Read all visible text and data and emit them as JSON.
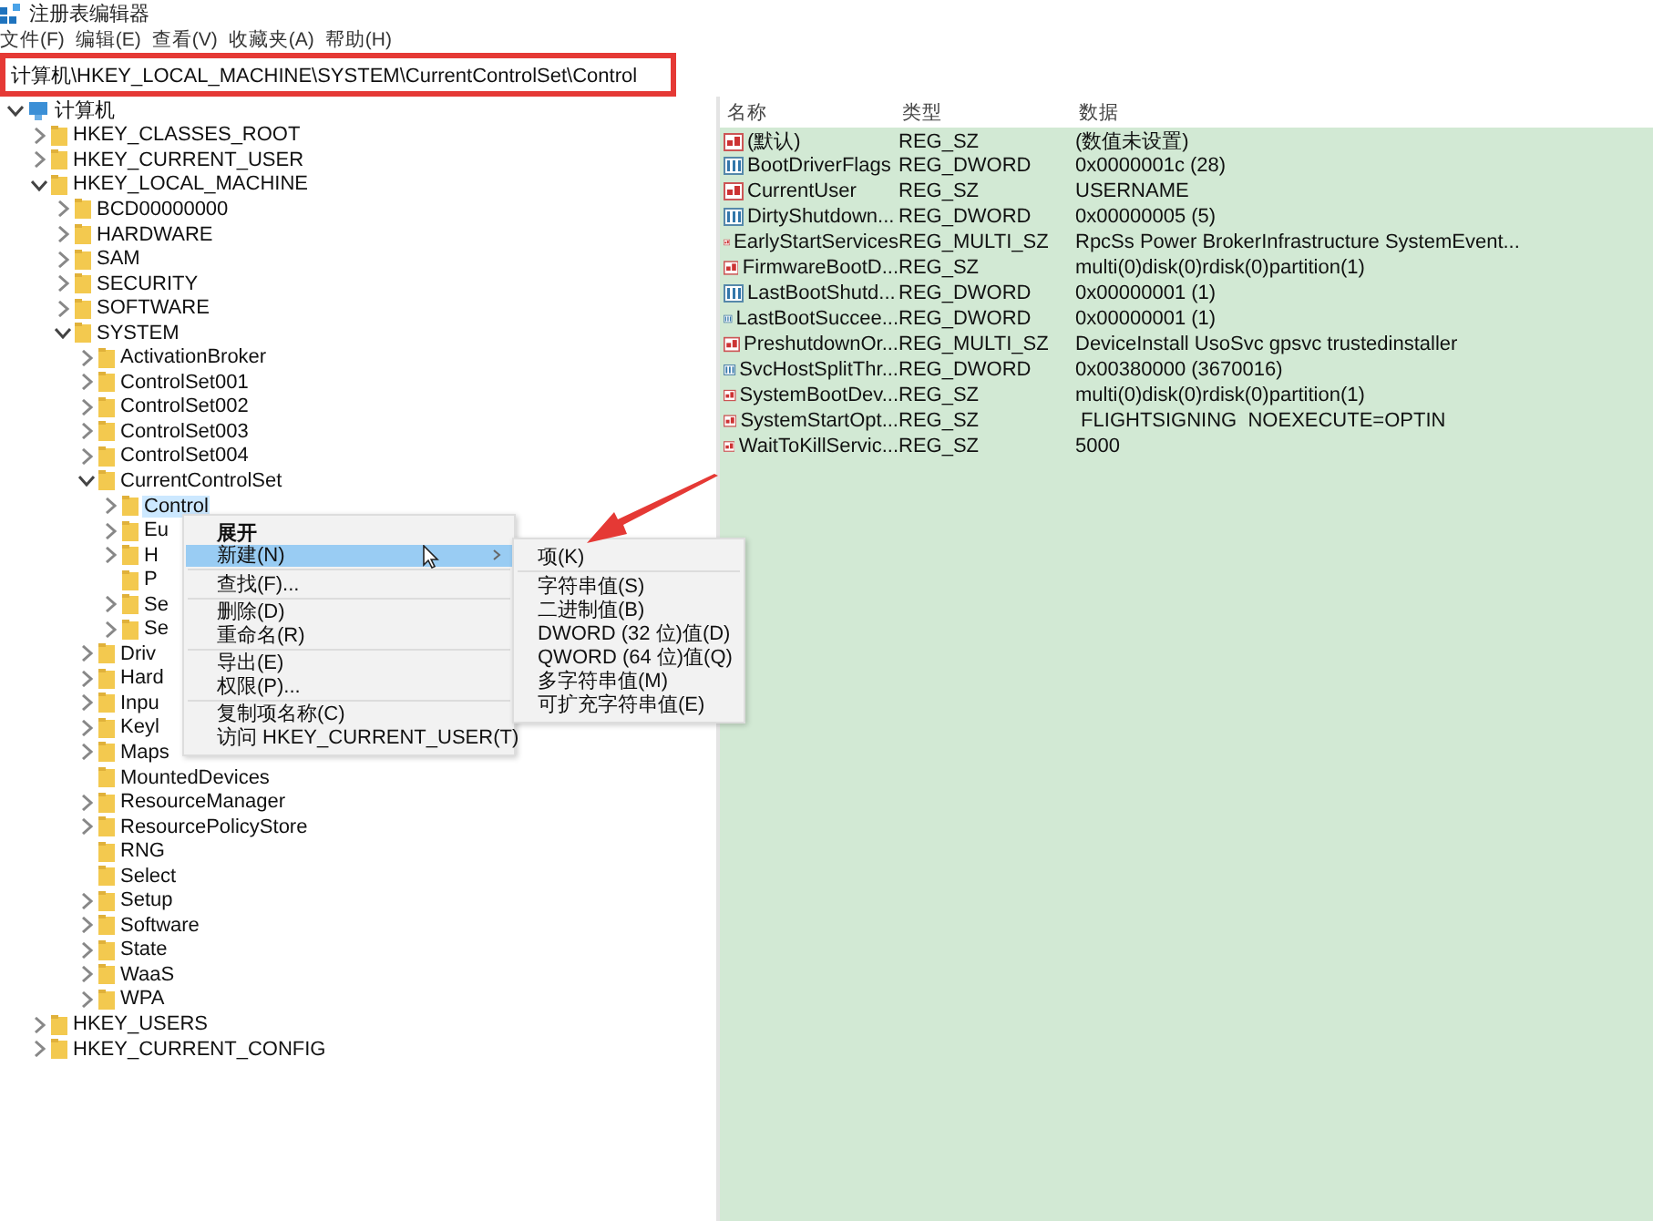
{
  "window": {
    "title": "注册表编辑器"
  },
  "menu_bar": [
    "文件(F)",
    "编辑(E)",
    "查看(V)",
    "收藏夹(A)",
    "帮助(H)"
  ],
  "address_bar": {
    "value": "计算机\\HKEY_LOCAL_MACHINE\\SYSTEM\\CurrentControlSet\\Control"
  },
  "tree": [
    {
      "label": "计算机",
      "kind": "computer",
      "expandable": true,
      "expanded": true,
      "selected": false,
      "children": [
        {
          "label": "HKEY_CLASSES_ROOT",
          "kind": "folder",
          "expandable": true,
          "expanded": false,
          "selected": false
        },
        {
          "label": "HKEY_CURRENT_USER",
          "kind": "folder",
          "expandable": true,
          "expanded": false,
          "selected": false
        },
        {
          "label": "HKEY_LOCAL_MACHINE",
          "kind": "folder",
          "expandable": true,
          "expanded": true,
          "selected": false,
          "children": [
            {
              "label": "BCD00000000",
              "kind": "folder",
              "expandable": true,
              "expanded": false,
              "selected": false
            },
            {
              "label": "HARDWARE",
              "kind": "folder",
              "expandable": true,
              "expanded": false,
              "selected": false
            },
            {
              "label": "SAM",
              "kind": "folder",
              "expandable": true,
              "expanded": false,
              "selected": false
            },
            {
              "label": "SECURITY",
              "kind": "folder",
              "expandable": true,
              "expanded": false,
              "selected": false
            },
            {
              "label": "SOFTWARE",
              "kind": "folder",
              "expandable": true,
              "expanded": false,
              "selected": false
            },
            {
              "label": "SYSTEM",
              "kind": "folder",
              "expandable": true,
              "expanded": true,
              "selected": false,
              "children": [
                {
                  "label": "ActivationBroker",
                  "kind": "folder",
                  "expandable": true,
                  "expanded": false,
                  "selected": false
                },
                {
                  "label": "ControlSet001",
                  "kind": "folder",
                  "expandable": true,
                  "expanded": false,
                  "selected": false
                },
                {
                  "label": "ControlSet002",
                  "kind": "folder",
                  "expandable": true,
                  "expanded": false,
                  "selected": false
                },
                {
                  "label": "ControlSet003",
                  "kind": "folder",
                  "expandable": true,
                  "expanded": false,
                  "selected": false
                },
                {
                  "label": "ControlSet004",
                  "kind": "folder",
                  "expandable": true,
                  "expanded": false,
                  "selected": false
                },
                {
                  "label": "CurrentControlSet",
                  "kind": "folder",
                  "expandable": true,
                  "expanded": true,
                  "selected": false,
                  "children": [
                    {
                      "label": "Control",
                      "kind": "folder",
                      "expandable": true,
                      "expanded": false,
                      "selected": true
                    },
                    {
                      "label": "Eu",
                      "kind": "folder",
                      "expandable": true,
                      "expanded": false,
                      "selected": false
                    },
                    {
                      "label": "H",
                      "kind": "folder",
                      "expandable": true,
                      "expanded": false,
                      "selected": false
                    },
                    {
                      "label": "P",
                      "kind": "folder",
                      "expandable": false,
                      "expanded": false,
                      "selected": false
                    },
                    {
                      "label": "Se",
                      "kind": "folder",
                      "expandable": true,
                      "expanded": false,
                      "selected": false
                    },
                    {
                      "label": "Se",
                      "kind": "folder",
                      "expandable": true,
                      "expanded": false,
                      "selected": false
                    }
                  ]
                },
                {
                  "label": "Driv",
                  "kind": "folder",
                  "expandable": true,
                  "expanded": false,
                  "selected": false
                },
                {
                  "label": "Hard",
                  "kind": "folder",
                  "expandable": true,
                  "expanded": false,
                  "selected": false
                },
                {
                  "label": "Inpu",
                  "kind": "folder",
                  "expandable": true,
                  "expanded": false,
                  "selected": false
                },
                {
                  "label": "Keyl",
                  "kind": "folder",
                  "expandable": true,
                  "expanded": false,
                  "selected": false
                },
                {
                  "label": "Maps",
                  "kind": "folder",
                  "expandable": true,
                  "expanded": false,
                  "selected": false
                },
                {
                  "label": "MountedDevices",
                  "kind": "folder",
                  "expandable": false,
                  "expanded": false,
                  "selected": false
                },
                {
                  "label": "ResourceManager",
                  "kind": "folder",
                  "expandable": true,
                  "expanded": false,
                  "selected": false
                },
                {
                  "label": "ResourcePolicyStore",
                  "kind": "folder",
                  "expandable": true,
                  "expanded": false,
                  "selected": false
                },
                {
                  "label": "RNG",
                  "kind": "folder",
                  "expandable": false,
                  "expanded": false,
                  "selected": false
                },
                {
                  "label": "Select",
                  "kind": "folder",
                  "expandable": false,
                  "expanded": false,
                  "selected": false
                },
                {
                  "label": "Setup",
                  "kind": "folder",
                  "expandable": true,
                  "expanded": false,
                  "selected": false
                },
                {
                  "label": "Software",
                  "kind": "folder",
                  "expandable": true,
                  "expanded": false,
                  "selected": false
                },
                {
                  "label": "State",
                  "kind": "folder",
                  "expandable": true,
                  "expanded": false,
                  "selected": false
                },
                {
                  "label": "WaaS",
                  "kind": "folder",
                  "expandable": true,
                  "expanded": false,
                  "selected": false
                },
                {
                  "label": "WPA",
                  "kind": "folder",
                  "expandable": true,
                  "expanded": false,
                  "selected": false
                }
              ]
            }
          ]
        },
        {
          "label": "HKEY_USERS",
          "kind": "folder",
          "expandable": true,
          "expanded": false,
          "selected": false
        },
        {
          "label": "HKEY_CURRENT_CONFIG",
          "kind": "folder",
          "expandable": true,
          "expanded": false,
          "selected": false
        }
      ]
    }
  ],
  "values_table": {
    "columns": [
      "名称",
      "类型",
      "数据"
    ],
    "rows": [
      {
        "kind": "string",
        "name": "(默认)",
        "type": "REG_SZ",
        "data": "(数值未设置)"
      },
      {
        "kind": "binary",
        "name": "BootDriverFlags",
        "type": "REG_DWORD",
        "data": "0x0000001c (28)"
      },
      {
        "kind": "string",
        "name": "CurrentUser",
        "type": "REG_SZ",
        "data": "USERNAME"
      },
      {
        "kind": "binary",
        "name": "DirtyShutdown...",
        "type": "REG_DWORD",
        "data": "0x00000005 (5)"
      },
      {
        "kind": "string",
        "name": "EarlyStartServices",
        "type": "REG_MULTI_SZ",
        "data": "RpcSs Power BrokerInfrastructure SystemEvent..."
      },
      {
        "kind": "string",
        "name": "FirmwareBootD...",
        "type": "REG_SZ",
        "data": "multi(0)disk(0)rdisk(0)partition(1)"
      },
      {
        "kind": "binary",
        "name": "LastBootShutd...",
        "type": "REG_DWORD",
        "data": "0x00000001 (1)"
      },
      {
        "kind": "binary",
        "name": "LastBootSuccee...",
        "type": "REG_DWORD",
        "data": "0x00000001 (1)"
      },
      {
        "kind": "string",
        "name": "PreshutdownOr...",
        "type": "REG_MULTI_SZ",
        "data": "DeviceInstall UsoSvc gpsvc trustedinstaller"
      },
      {
        "kind": "binary",
        "name": "SvcHostSplitThr...",
        "type": "REG_DWORD",
        "data": "0x00380000 (3670016)"
      },
      {
        "kind": "string",
        "name": "SystemBootDev...",
        "type": "REG_SZ",
        "data": "multi(0)disk(0)rdisk(0)partition(1)"
      },
      {
        "kind": "string",
        "name": "SystemStartOpt...",
        "type": "REG_SZ",
        "data": " FLIGHTSIGNING  NOEXECUTE=OPTIN"
      },
      {
        "kind": "string",
        "name": "WaitToKillServic...",
        "type": "REG_SZ",
        "data": "5000"
      }
    ]
  },
  "context_menu": {
    "items": [
      {
        "label": "展开",
        "kind": "default",
        "selected": false
      },
      {
        "label": "新建(N)",
        "kind": "submenu",
        "selected": true
      },
      {
        "kind": "separator"
      },
      {
        "label": "查找(F)...",
        "kind": "item",
        "selected": false
      },
      {
        "kind": "separator"
      },
      {
        "label": "删除(D)",
        "kind": "item",
        "selected": false
      },
      {
        "label": "重命名(R)",
        "kind": "item",
        "selected": false
      },
      {
        "kind": "separator"
      },
      {
        "label": "导出(E)",
        "kind": "item",
        "selected": false
      },
      {
        "label": "权限(P)...",
        "kind": "item",
        "selected": false
      },
      {
        "kind": "separator"
      },
      {
        "label": "复制项名称(C)",
        "kind": "item",
        "selected": false
      },
      {
        "label": "访问 HKEY_CURRENT_USER(T)",
        "kind": "item",
        "selected": false
      }
    ]
  },
  "submenu": {
    "items": [
      {
        "label": "项(K)",
        "kind": "item"
      },
      {
        "kind": "separator"
      },
      {
        "label": "字符串值(S)",
        "kind": "item"
      },
      {
        "label": "二进制值(B)",
        "kind": "item"
      },
      {
        "label": "DWORD (32 位)值(D)",
        "kind": "item"
      },
      {
        "label": "QWORD (64 位)值(Q)",
        "kind": "item"
      },
      {
        "label": "多字符串值(M)",
        "kind": "item"
      },
      {
        "label": "可扩充字符串值(E)",
        "kind": "item"
      }
    ]
  }
}
